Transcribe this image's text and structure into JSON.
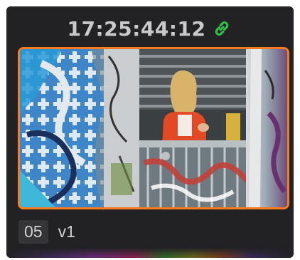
{
  "clip": {
    "timecode": "17:25:44:12",
    "link_icon": "link-icon",
    "number": "05",
    "track": "v1"
  },
  "colors": {
    "card_background": "#222225",
    "selection_border": "#ff7a1a",
    "link_icon": "#2fbf4a",
    "text": "#c9c9cc"
  }
}
